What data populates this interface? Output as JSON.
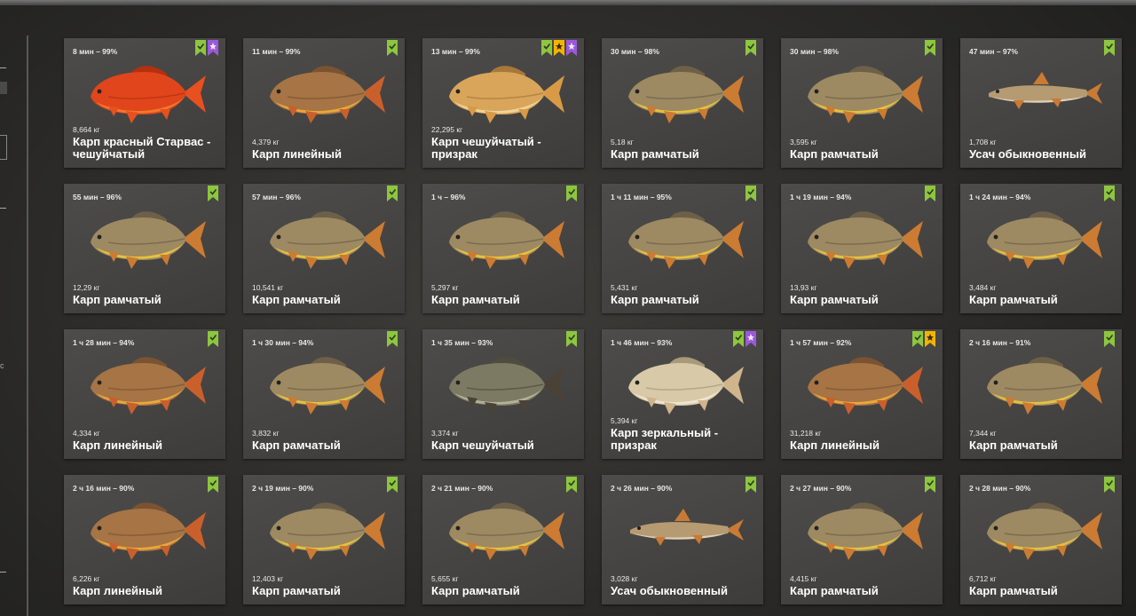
{
  "colors": {
    "badge_check": "#8dc63f",
    "badge_star": "#f4b400",
    "badge_purple": "#9b59d9"
  },
  "cards": [
    {
      "time": "8 мин – 99%",
      "weight": "8,664 кг",
      "name": "Карп красный Старвас - чешуйчатый",
      "badges": [
        "check",
        "purple"
      ],
      "fish": "red-carp"
    },
    {
      "time": "11 мин – 99%",
      "weight": "4,379 кг",
      "name": "Карп линейный",
      "badges": [
        "check"
      ],
      "fish": "line-carp"
    },
    {
      "time": "13 мин – 99%",
      "weight": "22,295 кг",
      "name": "Карп чешуйчатый - призрак",
      "badges": [
        "check",
        "star",
        "purple"
      ],
      "fish": "ghost-carp"
    },
    {
      "time": "30 мин – 98%",
      "weight": "5,18 кг",
      "name": "Карп рамчатый",
      "badges": [
        "check"
      ],
      "fish": "frame-carp"
    },
    {
      "time": "30 мин – 98%",
      "weight": "3,595 кг",
      "name": "Карп рамчатый",
      "badges": [
        "check"
      ],
      "fish": "frame-carp"
    },
    {
      "time": "47 мин – 97%",
      "weight": "1,708 кг",
      "name": "Усач обыкновенный",
      "badges": [
        "check"
      ],
      "fish": "barbel"
    },
    {
      "time": "55 мин – 96%",
      "weight": "12,29 кг",
      "name": "Карп рамчатый",
      "badges": [
        "check"
      ],
      "fish": "frame-carp"
    },
    {
      "time": "57 мин – 96%",
      "weight": "10,541 кг",
      "name": "Карп рамчатый",
      "badges": [
        "check"
      ],
      "fish": "frame-carp"
    },
    {
      "time": "1 ч – 96%",
      "weight": "5,297 кг",
      "name": "Карп рамчатый",
      "badges": [
        "check"
      ],
      "fish": "frame-carp"
    },
    {
      "time": "1 ч 11 мин – 95%",
      "weight": "5,431 кг",
      "name": "Карп рамчатый",
      "badges": [
        "check"
      ],
      "fish": "frame-carp"
    },
    {
      "time": "1 ч 19 мин – 94%",
      "weight": "13,93 кг",
      "name": "Карп рамчатый",
      "badges": [
        "check"
      ],
      "fish": "frame-carp"
    },
    {
      "time": "1 ч 24 мин – 94%",
      "weight": "3,484 кг",
      "name": "Карп рамчатый",
      "badges": [
        "check"
      ],
      "fish": "frame-carp"
    },
    {
      "time": "1 ч 28 мин – 94%",
      "weight": "4,334 кг",
      "name": "Карп линейный",
      "badges": [
        "check"
      ],
      "fish": "line-carp"
    },
    {
      "time": "1 ч 30 мин – 94%",
      "weight": "3,832 кг",
      "name": "Карп рамчатый",
      "badges": [
        "check"
      ],
      "fish": "frame-carp"
    },
    {
      "time": "1 ч 35 мин – 93%",
      "weight": "3,374 кг",
      "name": "Карп чешуйчатый",
      "badges": [
        "check"
      ],
      "fish": "scale-carp"
    },
    {
      "time": "1 ч 46 мин – 93%",
      "weight": "5,394 кг",
      "name": "Карп зеркальный - призрак",
      "badges": [
        "check",
        "purple"
      ],
      "fish": "ghost-mirror"
    },
    {
      "time": "1 ч 57 мин – 92%",
      "weight": "31,218 кг",
      "name": "Карп линейный",
      "badges": [
        "check",
        "star"
      ],
      "fish": "line-carp"
    },
    {
      "time": "2 ч 16 мин – 91%",
      "weight": "7,344 кг",
      "name": "Карп рамчатый",
      "badges": [
        "check"
      ],
      "fish": "frame-carp"
    },
    {
      "time": "2 ч 16 мин – 90%",
      "weight": "6,226 кг",
      "name": "Карп линейный",
      "badges": [
        "check"
      ],
      "fish": "line-carp"
    },
    {
      "time": "2 ч 19 мин – 90%",
      "weight": "12,403 кг",
      "name": "Карп рамчатый",
      "badges": [
        "check"
      ],
      "fish": "frame-carp"
    },
    {
      "time": "2 ч 21 мин – 90%",
      "weight": "5,655 кг",
      "name": "Карп рамчатый",
      "badges": [
        "check"
      ],
      "fish": "frame-carp"
    },
    {
      "time": "2 ч 26 мин – 90%",
      "weight": "3,028 кг",
      "name": "Усач обыкновенный",
      "badges": [
        "check"
      ],
      "fish": "barbel"
    },
    {
      "time": "2 ч 27 мин – 90%",
      "weight": "4,415 кг",
      "name": "Карп рамчатый",
      "badges": [
        "check"
      ],
      "fish": "frame-carp"
    },
    {
      "time": "2 ч 28 мин – 90%",
      "weight": "6,712 кг",
      "name": "Карп рамчатый",
      "badges": [
        "check"
      ],
      "fish": "frame-carp"
    }
  ]
}
